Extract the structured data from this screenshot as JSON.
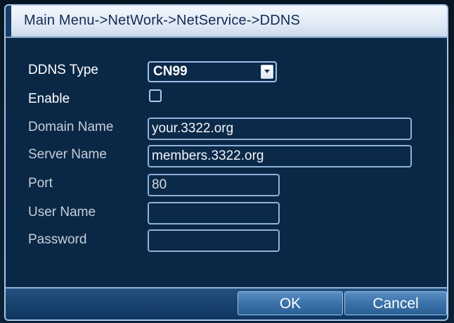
{
  "window": {
    "title": "Main Menu->NetWork->NetService->DDNS"
  },
  "form": {
    "ddns_type": {
      "label": "DDNS Type",
      "value": "CN99"
    },
    "enable": {
      "label": "Enable",
      "checked": false
    },
    "domain_name": {
      "label": "Domain Name",
      "value": "your.3322.org"
    },
    "server_name": {
      "label": "Server Name",
      "value": "members.3322.org"
    },
    "port": {
      "label": "Port",
      "value": "80"
    },
    "user_name": {
      "label": "User Name",
      "value": ""
    },
    "password": {
      "label": "Password",
      "value": ""
    }
  },
  "buttons": {
    "ok": "OK",
    "cancel": "Cancel"
  },
  "colors": {
    "title_bg": "#e6eef8",
    "title_text": "#112a58",
    "panel_bg": "#0a2846",
    "field_border": "#8fb1db",
    "button_bg": "#3d74ab"
  }
}
